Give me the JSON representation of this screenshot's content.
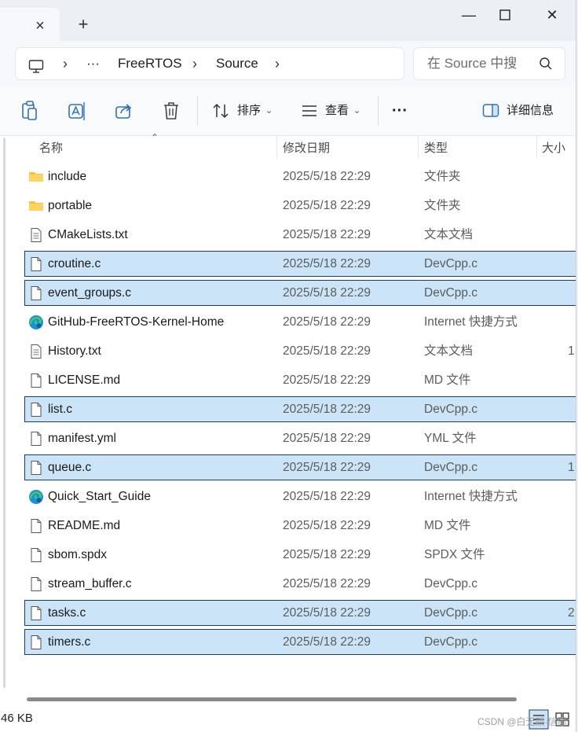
{
  "window": {
    "tab_close": "×",
    "tab_new": "+",
    "minimize": "—",
    "close": "✕"
  },
  "address": {
    "more": "···",
    "crumbs": [
      "FreeRTOS",
      "Source"
    ],
    "search_placeholder": "在 Source 中搜"
  },
  "toolbar": {
    "sort_label": "排序",
    "view_label": "查看",
    "more": "···",
    "details_label": "详细信息"
  },
  "columns": {
    "name": "名称",
    "date": "修改日期",
    "type": "类型",
    "size": "大小"
  },
  "files": [
    {
      "name": "include",
      "date": "2025/5/18 22:29",
      "type": "文件夹",
      "size": "",
      "icon": "folder-icon",
      "selected": false
    },
    {
      "name": "portable",
      "date": "2025/5/18 22:29",
      "type": "文件夹",
      "size": "",
      "icon": "folder-icon",
      "selected": false
    },
    {
      "name": "CMakeLists.txt",
      "date": "2025/5/18 22:29",
      "type": "文本文档",
      "size": "",
      "icon": "text-file-icon",
      "selected": false
    },
    {
      "name": "croutine.c",
      "date": "2025/5/18 22:29",
      "type": "DevCpp.c",
      "size": "",
      "icon": "file-icon",
      "selected": true
    },
    {
      "name": "event_groups.c",
      "date": "2025/5/18 22:29",
      "type": "DevCpp.c",
      "size": "",
      "icon": "file-icon",
      "selected": true
    },
    {
      "name": "GitHub-FreeRTOS-Kernel-Home",
      "date": "2025/5/18 22:29",
      "type": "Internet 快捷方式",
      "size": "",
      "icon": "edge-shortcut-icon",
      "selected": false
    },
    {
      "name": "History.txt",
      "date": "2025/5/18 22:29",
      "type": "文本文档",
      "size": "1",
      "icon": "text-file-icon",
      "selected": false
    },
    {
      "name": "LICENSE.md",
      "date": "2025/5/18 22:29",
      "type": "MD 文件",
      "size": "",
      "icon": "file-icon",
      "selected": false
    },
    {
      "name": "list.c",
      "date": "2025/5/18 22:29",
      "type": "DevCpp.c",
      "size": "",
      "icon": "file-icon",
      "selected": true
    },
    {
      "name": "manifest.yml",
      "date": "2025/5/18 22:29",
      "type": "YML 文件",
      "size": "",
      "icon": "file-icon",
      "selected": false
    },
    {
      "name": "queue.c",
      "date": "2025/5/18 22:29",
      "type": "DevCpp.c",
      "size": "1",
      "icon": "file-icon",
      "selected": true
    },
    {
      "name": "Quick_Start_Guide",
      "date": "2025/5/18 22:29",
      "type": "Internet 快捷方式",
      "size": "",
      "icon": "edge-shortcut-icon",
      "selected": false
    },
    {
      "name": "README.md",
      "date": "2025/5/18 22:29",
      "type": "MD 文件",
      "size": "",
      "icon": "file-icon",
      "selected": false
    },
    {
      "name": "sbom.spdx",
      "date": "2025/5/18 22:29",
      "type": "SPDX 文件",
      "size": "",
      "icon": "file-icon",
      "selected": false
    },
    {
      "name": "stream_buffer.c",
      "date": "2025/5/18 22:29",
      "type": "DevCpp.c",
      "size": "",
      "icon": "file-icon",
      "selected": false
    },
    {
      "name": "tasks.c",
      "date": "2025/5/18 22:29",
      "type": "DevCpp.c",
      "size": "2",
      "icon": "file-icon",
      "selected": true
    },
    {
      "name": "timers.c",
      "date": "2025/5/18 22:29",
      "type": "DevCpp.c",
      "size": "",
      "icon": "file-icon",
      "selected": true
    }
  ],
  "status": {
    "text": "46 KB"
  },
  "watermark": "CSDN @白无颜·信圆"
}
